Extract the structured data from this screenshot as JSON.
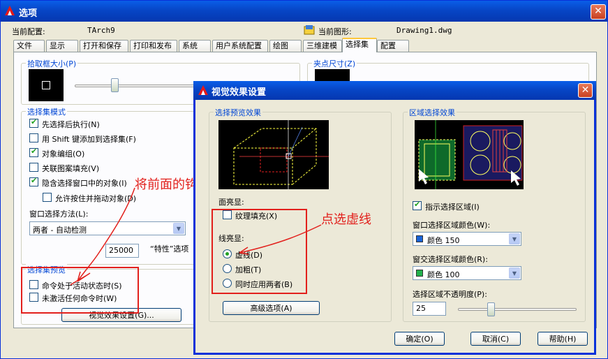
{
  "main_window": {
    "title": "选项",
    "current_profile_label": "当前配置:",
    "current_profile_value": "TArch9",
    "current_drawing_label": "当前图形:",
    "current_drawing_value": "Drawing1.dwg",
    "tabs": [
      "文件",
      "显示",
      "打开和保存",
      "打印和发布",
      "系统",
      "用户系统配置",
      "绘图",
      "三维建模",
      "选择集",
      "配置"
    ],
    "active_tab": "选择集",
    "pickbox_group": "拾取框大小(P)",
    "grip_group": "夹点尺寸(Z)",
    "selection_modes_group": "选择集模式",
    "modes": [
      {
        "label": "先选择后执行(N)",
        "checked": true
      },
      {
        "label": "用 Shift 键添加到选择集(F)",
        "checked": false
      },
      {
        "label": "对象编组(O)",
        "checked": true
      },
      {
        "label": "关联图案填充(V)",
        "checked": false
      },
      {
        "label": "隐含选择窗口中的对象(I)",
        "checked": true
      },
      {
        "label": "允许按住并拖动对象(D)",
        "checked": false
      }
    ],
    "window_method_label": "窗口选择方法(L):",
    "window_method_value": "两者 - 自动检测",
    "limit_value": "25000",
    "limit_label": "“特性”选项",
    "preview_group": "选择集预览",
    "preview_options": [
      {
        "label": "命令处于活动状态时(S)",
        "checked": false
      },
      {
        "label": "未激活任何命令时(W)",
        "checked": false
      }
    ],
    "visual_effects_button": "视觉效果设置(G)..."
  },
  "annotations": {
    "remove_check": "将前面的钩点掉",
    "click_dashed": "点选虚线"
  },
  "dialog": {
    "title": "视觉效果设置",
    "preview_group": "选择预览效果",
    "face_highlight_label": "面亮显:",
    "texture_fill": {
      "label": "纹理填充(X)",
      "checked": false
    },
    "line_highlight_label": "线亮显:",
    "line_options": [
      {
        "label": "虚线(D)",
        "selected": true
      },
      {
        "label": "加粗(T)",
        "selected": false
      },
      {
        "label": "同时应用两者(B)",
        "selected": false
      }
    ],
    "advanced_button": "高级选项(A)",
    "area_group": "区域选择效果",
    "indicate_area": {
      "label": "指示选择区域(I)",
      "checked": true
    },
    "window_color_label": "窗口选择区域颜色(W):",
    "window_color_value": "颜色 150",
    "window_color_swatch": "#1a64d8",
    "crossing_color_label": "窗交选择区域颜色(R):",
    "crossing_color_value": "颜色 100",
    "crossing_color_swatch": "#22b14c",
    "opacity_label": "选择区域不透明度(P):",
    "opacity_value": "25",
    "ok_button": "确定(O)",
    "cancel_button": "取消(C)",
    "help_button": "帮助(H)"
  }
}
